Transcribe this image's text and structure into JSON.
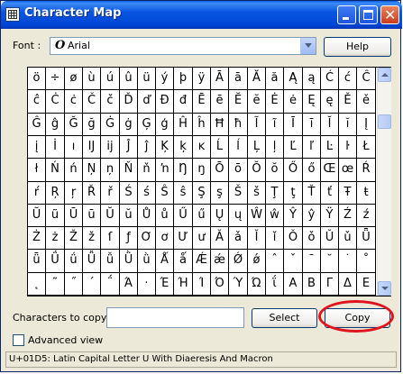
{
  "window": {
    "title": "Character Map",
    "icon": "character-map-icon",
    "controls": [
      "minimize-icon",
      "maximize-icon",
      "close-icon"
    ],
    "accent": "#0a5ce5"
  },
  "font": {
    "label": "Font :",
    "icon_glyph": "O",
    "value": "Arial"
  },
  "help_button": "Help",
  "grid": {
    "rows": [
      [
        "ö",
        "÷",
        "ø",
        "ù",
        "ú",
        "û",
        "ü",
        "ý",
        "þ",
        "ÿ",
        "Ā",
        "ā",
        "Ă",
        "ă",
        "Ą",
        "ą",
        "Ć",
        "ć",
        "Ĉ"
      ],
      [
        "ĉ",
        "Ċ",
        "ċ",
        "Č",
        "č",
        "Ď",
        "ď",
        "Đ",
        "đ",
        "Ē",
        "ē",
        "Ĕ",
        "ĕ",
        "Ė",
        "ė",
        "Ę",
        "ę",
        "Ě",
        "ě"
      ],
      [
        "Ĝ",
        "ĝ",
        "Ğ",
        "ğ",
        "Ġ",
        "ġ",
        "Ģ",
        "ģ",
        "Ĥ",
        "ĥ",
        "Ħ",
        "ħ",
        "Ĩ",
        "ĩ",
        "Ī",
        "ī",
        "Ĭ",
        "ĭ",
        "Į"
      ],
      [
        "į",
        "İ",
        "ı",
        "Ĳ",
        "ĳ",
        "Ĵ",
        "ĵ",
        "Ķ",
        "ķ",
        "ĸ",
        "Ĺ",
        "ĺ",
        "Ļ",
        "ļ",
        "Ľ",
        "ľ",
        "Ŀ",
        "ŀ",
        "Ł"
      ],
      [
        "ł",
        "Ń",
        "ń",
        "Ņ",
        "ņ",
        "Ň",
        "ň",
        "ŉ",
        "Ŋ",
        "ŋ",
        "Ō",
        "ō",
        "Ŏ",
        "ŏ",
        "Ő",
        "ő",
        "Œ",
        "œ",
        "Ŕ"
      ],
      [
        "ŕ",
        "Ŗ",
        "ŗ",
        "Ř",
        "ř",
        "Ś",
        "ś",
        "Ŝ",
        "ŝ",
        "Ş",
        "ş",
        "Š",
        "š",
        "Ţ",
        "ţ",
        "Ť",
        "ť",
        "Ŧ",
        "ŧ"
      ],
      [
        "Ũ",
        "ũ",
        "Ū",
        "ū",
        "Ŭ",
        "ŭ",
        "Ů",
        "ů",
        "Ű",
        "ű",
        "Ų",
        "ų",
        "Ŵ",
        "ŵ",
        "Ŷ",
        "ŷ",
        "Ÿ",
        "Ź",
        "ź"
      ],
      [
        "Ż",
        "ż",
        "Ž",
        "ž",
        "ſ",
        "ƒ",
        "Ơ",
        "ơ",
        "Ư",
        "ư",
        "Ǎ",
        "ǎ",
        "Ǐ",
        "ǐ",
        "Ǒ",
        "ǒ",
        "Ǔ",
        "ǔ",
        "Ǖ"
      ],
      [
        "ǖ",
        "Ǘ",
        "ǘ",
        "Ǚ",
        "ǚ",
        "Ǜ",
        "ǜ",
        "Ǻ",
        "ǻ",
        "Ǽ",
        "ǽ",
        "Ǿ",
        "ǿ",
        "ˆ",
        "ˇ",
        "ˉ",
        "˘",
        "˙",
        "˚"
      ],
      [
        "˛",
        "˜",
        "˝",
        "΄",
        "΅",
        "Ά",
        "·",
        "Έ",
        "Ή",
        "Ί",
        "Ό",
        "Ύ",
        "Ώ",
        "ΐ",
        "Α",
        "Β",
        "Γ",
        "Δ",
        "Ε"
      ]
    ],
    "selected_cell": "Ǖ"
  },
  "copy": {
    "label": "Characters to copy :",
    "value": "",
    "select_button": "Select",
    "copy_button": "Copy",
    "highlight_color": "#e0141e"
  },
  "advanced_view": {
    "label": "Advanced view",
    "checked": false
  },
  "status": "U+01D5: Latin Capital Letter U With Diaeresis And Macron"
}
